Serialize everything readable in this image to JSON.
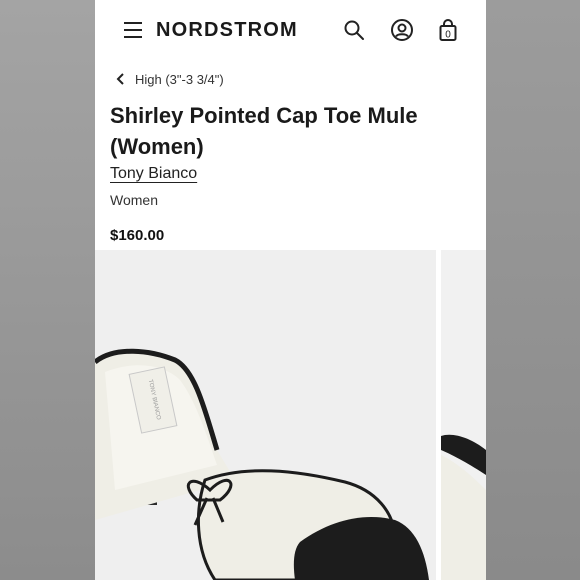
{
  "header": {
    "logo": "NORDSTROM",
    "icons": [
      "menu-icon",
      "search-icon",
      "account-icon",
      "bag-icon"
    ],
    "bag_count": "0"
  },
  "breadcrumb": {
    "label": "High (3\"-3 3/4\")"
  },
  "product": {
    "title": "Shirley Pointed Cap Toe Mule (Women)",
    "brand": "Tony Bianco",
    "gender": "Women",
    "price": "$160.00",
    "insole_label": "TONY BIANCO"
  },
  "colors": {
    "text": "#1a1a1a",
    "shoe_body": "#efeee6",
    "shoe_trim": "#1c1c1c",
    "heel": "#cda37c"
  }
}
